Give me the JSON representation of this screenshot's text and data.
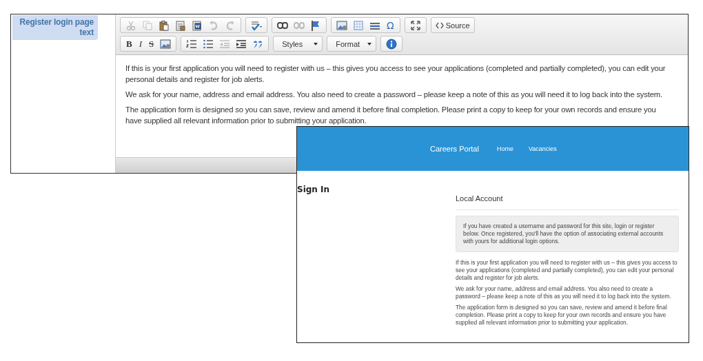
{
  "field_label": "Register login page text",
  "toolbar": [
    [
      [
        {
          "kind": "icon",
          "disabled": true
        },
        {
          "kind": "icon",
          "disabled": true
        },
        {
          "kind": "icon",
          "disabled": false
        },
        {
          "kind": "icon",
          "disabled": false
        },
        {
          "kind": "icon",
          "disabled": false
        },
        {
          "kind": "icon",
          "disabled": true
        },
        {
          "kind": "icon",
          "disabled": true
        }
      ],
      [
        {
          "kind": "icon",
          "disabled": false
        }
      ],
      [
        {
          "kind": "icon",
          "disabled": false
        },
        {
          "kind": "icon",
          "disabled": true
        },
        {
          "kind": "icon",
          "disabled": false
        }
      ],
      [
        {
          "kind": "icon",
          "disabled": false
        },
        {
          "kind": "icon",
          "disabled": false
        },
        {
          "kind": "icon",
          "disabled": false
        },
        {
          "kind": "char",
          "label": "Ω"
        }
      ],
      [
        {
          "kind": "icon",
          "disabled": false
        }
      ],
      [
        {
          "kind": "source",
          "label": "Source"
        }
      ]
    ],
    [
      [
        {
          "kind": "bold",
          "label": "B"
        },
        {
          "kind": "italic",
          "label": "I"
        },
        {
          "kind": "strike",
          "label": "S"
        },
        {
          "kind": "icon",
          "disabled": false
        }
      ],
      [
        {
          "kind": "icon",
          "disabled": false
        },
        {
          "kind": "icon",
          "disabled": false
        },
        {
          "kind": "icon",
          "disabled": true
        },
        {
          "kind": "icon",
          "disabled": false
        },
        {
          "kind": "icon",
          "disabled": false
        }
      ],
      [
        {
          "kind": "dropdown",
          "label": "Styles"
        }
      ],
      [
        {
          "kind": "dropdown",
          "label": "Format"
        }
      ],
      [
        {
          "kind": "icon",
          "disabled": false
        }
      ]
    ]
  ],
  "editor_paragraphs": [
    "If this is your first application you will need to register with us – this gives you access to see your applications (completed and partially completed), you can edit your personal details and register for job alerts.",
    "We ask for your name, address and email address. You also need to create a password – please keep a note of this as you will need it to log back into the system.",
    "The application form is designed so you can save, review and amend it before final completion. Please print a copy to keep for your own records and ensure you have supplied all relevant information prior to submitting your application."
  ],
  "preview": {
    "brand": "Careers Portal",
    "nav": [
      {
        "label": "Home"
      },
      {
        "label": "Vacancies"
      }
    ],
    "heading": "Sign In",
    "section": "Local Account",
    "notice": "If you have created a username and password for this site, login or register below. Once registered, you'll have the option of associating external accounts with yours for additional login options.",
    "paragraphs": [
      "If this is your first application you will need to register with us – this gives you access to see your applications (completed and partially completed), you can edit your personal details and register for job alerts.",
      "We ask for your name, address and email address. You also need to create a password – please keep a note of this as you will need it to log back into the system.",
      "The application form is designed so you can save, review and amend it before final completion. Please print a copy to keep for your own records and ensure you have supplied all relevant information prior to submitting your application."
    ]
  }
}
